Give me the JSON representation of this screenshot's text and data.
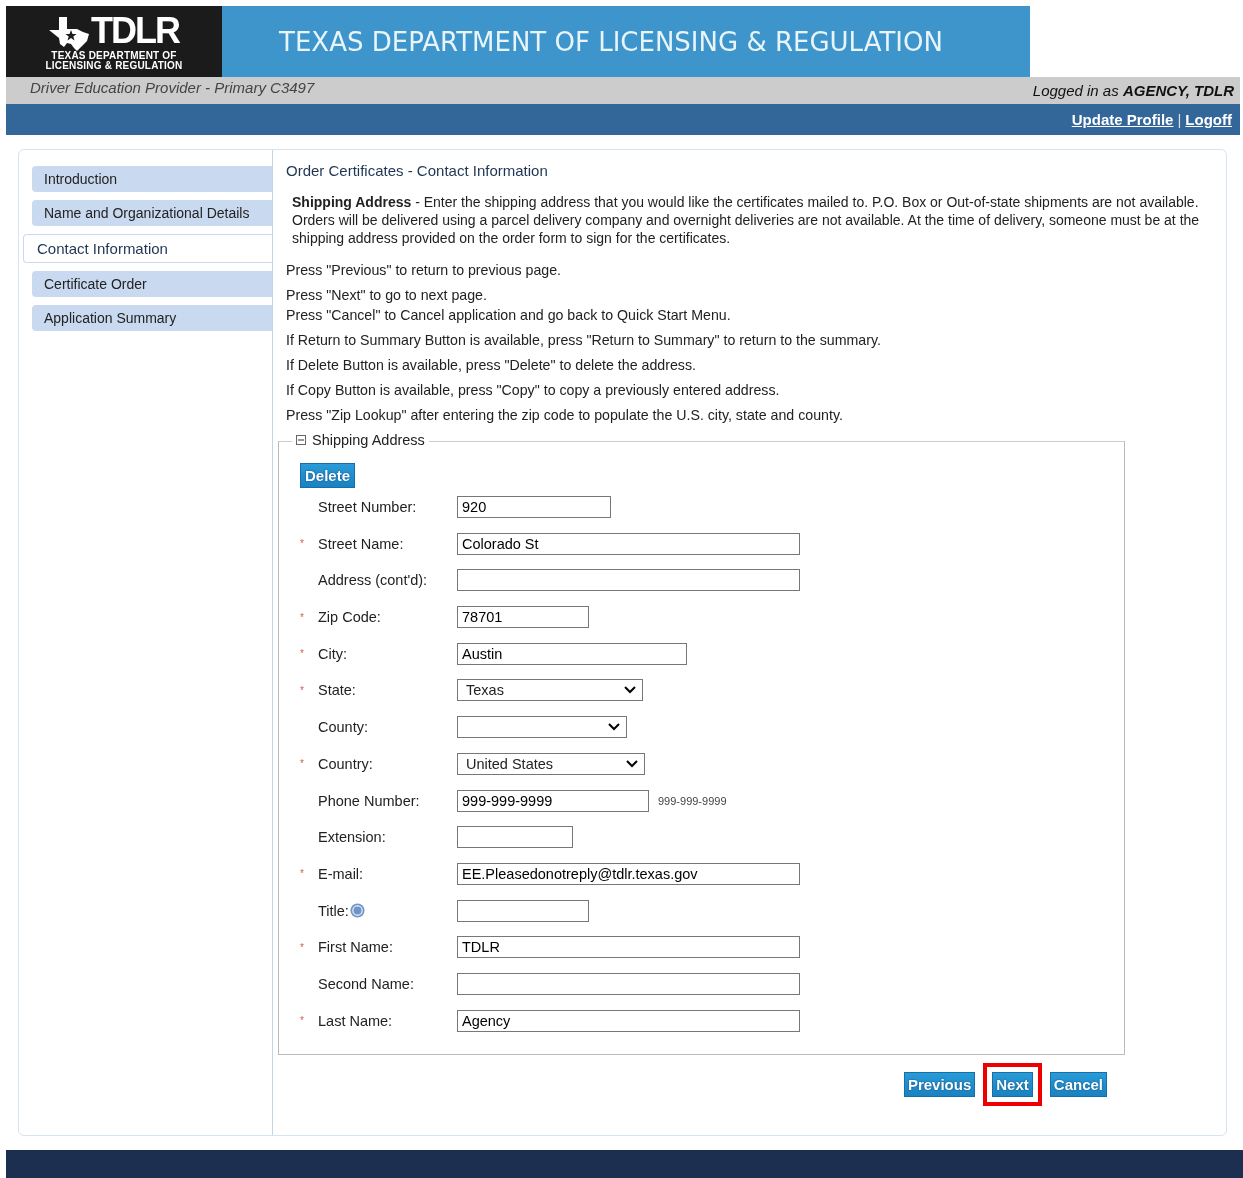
{
  "header": {
    "logo_text": "TDLR",
    "logo_subtitle": [
      "TEXAS DEPARTMENT OF",
      "LICENSING & REGULATION"
    ],
    "banner_title": "TEXAS DEPARTMENT OF LICENSING & REGULATION",
    "provider": "Driver Education Provider - Primary C3497",
    "logged_in_prefix": "Logged in as",
    "logged_in_user": "AGENCY, TDLR",
    "links": [
      "Update Profile",
      "Logoff"
    ],
    "link_separator": "|"
  },
  "sidebar": {
    "items": [
      {
        "label": "Introduction",
        "selected": false
      },
      {
        "label": "Name and Organizational Details",
        "selected": false
      },
      {
        "label": "Contact Information",
        "selected": true
      },
      {
        "label": "Certificate Order",
        "selected": false
      },
      {
        "label": "Application Summary",
        "selected": false
      }
    ]
  },
  "page_title": "Order Certificates - Contact Information",
  "intro": "**Shipping Address** - Enter the shipping address that you would like the certificates mailed to. P.O. Box or Out-of-state shipments are not available. Orders will be delivered using a parcel delivery company and overnight deliveries are not available. At the time of delivery, someone must be at the shipping address provided on the order form to sign for the certificates.",
  "instructions": [
    "Press \"Previous\" to return to previous page.",
    "Press \"Next\" to go to next page.",
    "Press \"Cancel\" to Cancel application and go back to Quick Start Menu.",
    "If Return to Summary Button is available, press \"Return to Summary\" to return to the summary.",
    "If Delete Button is available, press \"Delete\" to delete the address.",
    "If Copy Button is available, press \"Copy\" to copy a previously entered address.",
    "Press \"Zip Lookup\" after entering the zip code to populate the U.S. city, state and county."
  ],
  "section": {
    "title": "Shipping Address",
    "expanded": true,
    "delete_button": "Delete",
    "required_mark": "*",
    "fields": [
      {
        "label": "Street Number:",
        "required": false,
        "kind": "text",
        "value": "920"
      },
      {
        "label": "Street Name:",
        "required": true,
        "kind": "text",
        "value": "Colorado St"
      },
      {
        "label": "Address (cont'd):",
        "required": false,
        "kind": "text"
      },
      {
        "label": "Zip Code:",
        "required": true,
        "kind": "text",
        "value": "78701"
      },
      {
        "label": "City:",
        "required": true,
        "kind": "text",
        "value": "Austin"
      },
      {
        "label": "State:",
        "required": true,
        "kind": "select",
        "value": "Texas"
      },
      {
        "label": "County:",
        "required": false,
        "kind": "select"
      },
      {
        "label": "Country:",
        "required": true,
        "kind": "select",
        "value": "United States"
      },
      {
        "label": "Phone Number:",
        "required": false,
        "kind": "text",
        "value": "999-999-9999",
        "hint": "999-999-9999"
      },
      {
        "label": "Extension:",
        "required": false,
        "kind": "text"
      },
      {
        "label": "E-mail:",
        "required": true,
        "kind": "text",
        "value": "EE.Pleasedonotreply@tdlr.texas.gov"
      },
      {
        "label": "Title:",
        "required": false,
        "kind": "text",
        "help": true
      },
      {
        "label": "First Name:",
        "required": true,
        "kind": "text",
        "value": "TDLR"
      },
      {
        "label": "Second Name:",
        "required": false,
        "kind": "text"
      },
      {
        "label": "Last Name:",
        "required": true,
        "kind": "text",
        "value": "Agency"
      }
    ]
  },
  "buttons": [
    {
      "label": "Previous",
      "highlighted": false
    },
    {
      "label": "Next",
      "highlighted": true
    },
    {
      "label": "Cancel",
      "highlighted": false
    }
  ]
}
